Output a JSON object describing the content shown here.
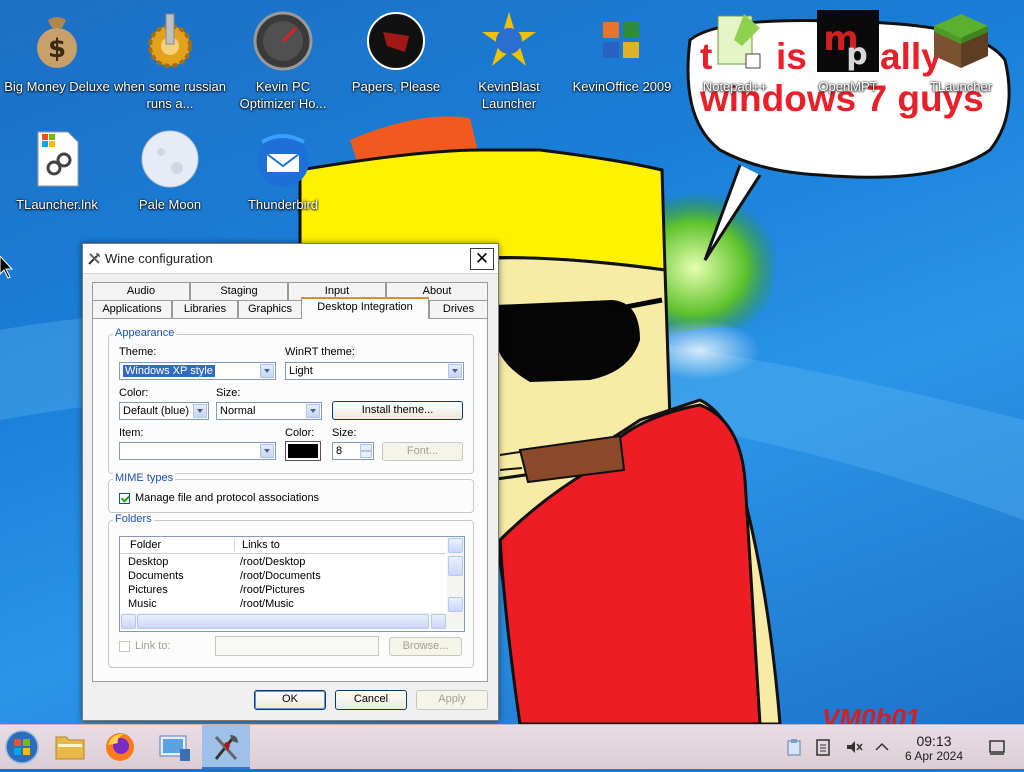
{
  "desktop": {
    "icons": [
      {
        "label": "Big Money Deluxe",
        "icon": "money-bag-icon"
      },
      {
        "label": "when some russian runs a...",
        "icon": "gear-icon"
      },
      {
        "label": "Kevin PC Optimizer Ho...",
        "icon": "speedometer-icon"
      },
      {
        "label": "Papers, Please",
        "icon": "papers-please-icon"
      },
      {
        "label": "KevinBlast Launcher",
        "icon": "blast-icon"
      },
      {
        "label": "KevinOffice 2009",
        "icon": "office-icon"
      },
      {
        "label": "Notepad++",
        "icon": "notepad-icon"
      },
      {
        "label": "OpenMPT",
        "icon": "openmpt-icon"
      },
      {
        "label": "TLauncher",
        "icon": "grass-block-icon"
      },
      {
        "label": "TLauncher.lnk",
        "icon": "shortcut-icon"
      },
      {
        "label": "Pale Moon",
        "icon": "moon-icon"
      },
      {
        "label": "Thunderbird",
        "icon": "thunderbird-icon"
      }
    ],
    "wallpaper_text": {
      "line1_a": "t",
      "line1_b": "is",
      "line1_c": "ally",
      "line2": "windows 7 guys",
      "signature": "VM0b01"
    }
  },
  "window": {
    "title": "Wine configuration",
    "tabs_row1": [
      "Audio",
      "Staging",
      "Input",
      "About"
    ],
    "tabs_row2": [
      "Applications",
      "Libraries",
      "Graphics",
      "Desktop Integration",
      "Drives"
    ],
    "active_tab": "Desktop Integration",
    "appearance": {
      "group_label": "Appearance",
      "theme_label": "Theme:",
      "theme_value": "Windows XP style",
      "winrt_label": "WinRT theme:",
      "winrt_value": "Light",
      "color_label": "Color:",
      "color_value": "Default (blue)",
      "size_label": "Size:",
      "size_value": "Normal",
      "install_button": "Install theme...",
      "item_label": "Item:",
      "item_value": "",
      "item_color_label": "Color:",
      "item_color_swatch": "#000000",
      "item_size_label": "Size:",
      "item_size_value": "8",
      "font_button": "Font..."
    },
    "mime": {
      "group_label": "MIME types",
      "checkbox_label": "Manage file and protocol associations",
      "checked": true
    },
    "folders": {
      "group_label": "Folders",
      "columns": [
        "Folder",
        "Links to"
      ],
      "rows": [
        {
          "folder": "Desktop",
          "link": "/root/Desktop"
        },
        {
          "folder": "Documents",
          "link": "/root/Documents"
        },
        {
          "folder": "Pictures",
          "link": "/root/Pictures"
        },
        {
          "folder": "Music",
          "link": "/root/Music"
        }
      ],
      "link_to_label": "Link to:",
      "link_to_value": "",
      "browse_button": "Browse..."
    },
    "buttons": {
      "ok": "OK",
      "cancel": "Cancel",
      "apply": "Apply"
    }
  },
  "taskbar": {
    "items": [
      {
        "name": "start-button",
        "icon": "windows-orb-icon"
      },
      {
        "name": "file-manager",
        "icon": "folder-icon"
      },
      {
        "name": "firefox",
        "icon": "firefox-icon"
      },
      {
        "name": "system-settings",
        "icon": "settings-icon"
      },
      {
        "name": "wine-config",
        "icon": "wine-icon",
        "active": true
      }
    ],
    "tray": [
      "clipboard-icon",
      "notes-icon",
      "volume-muted-icon",
      "chevron-up-icon"
    ],
    "clock": {
      "time": "09:13",
      "date": "6 Apr 2024"
    },
    "show_desktop": "show-desktop-icon"
  },
  "colors": {
    "desktop_blue": "#1a7fd8",
    "accent_tab": "#e68b2c",
    "group_title": "#1c52b6",
    "selection": "#316ac5",
    "wallpaper_text": "#e8202a"
  }
}
